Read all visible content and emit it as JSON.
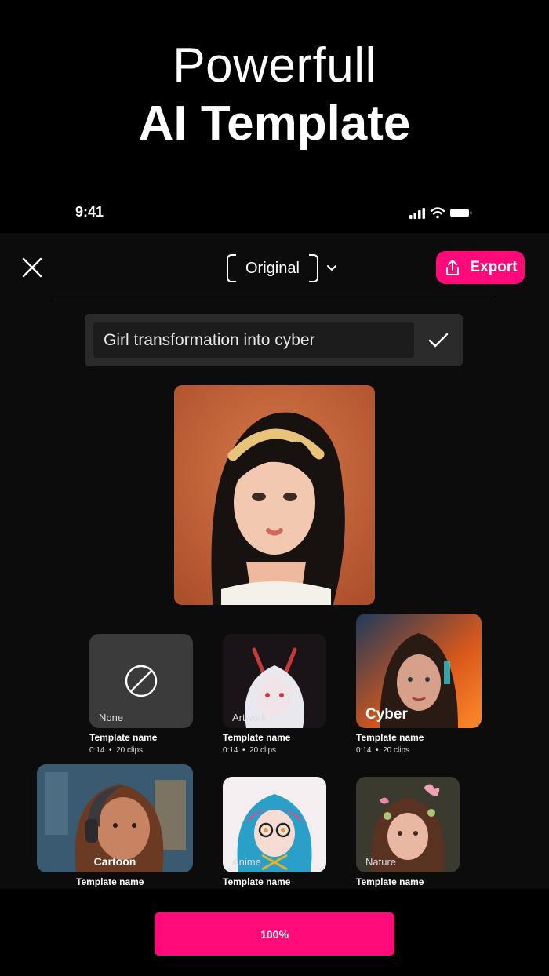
{
  "hero": {
    "line1": "Powerfull",
    "line2": "AI Template"
  },
  "status_bar": {
    "time": "9:41"
  },
  "toolbar": {
    "ratio_label": "Original",
    "export_label": "Export"
  },
  "prompt": {
    "value": "Girl transformation into cyber"
  },
  "templates": [
    {
      "label": "None",
      "name": "Template name",
      "duration": "0:14",
      "clips": "20 clips"
    },
    {
      "label": "Artwork",
      "name": "Template name",
      "duration": "0:14",
      "clips": "20 clips"
    },
    {
      "label": "Cyber",
      "name": "Template name",
      "duration": "0:14",
      "clips": "20 clips"
    },
    {
      "label": "Cartoon",
      "name": "Template name"
    },
    {
      "label": "Anime",
      "name": "Template name"
    },
    {
      "label": "Nature",
      "name": "Template name"
    }
  ],
  "meta_separator": "•",
  "progress": {
    "label": "100%"
  },
  "colors": {
    "accent": "#ff0a78",
    "panel": "#0c0c0c",
    "input_bg": "#1c1c1c"
  },
  "icons": [
    "close-icon",
    "chevron-down-icon",
    "share-icon",
    "check-icon",
    "none-icon",
    "signal-icon",
    "wifi-icon",
    "battery-icon"
  ]
}
